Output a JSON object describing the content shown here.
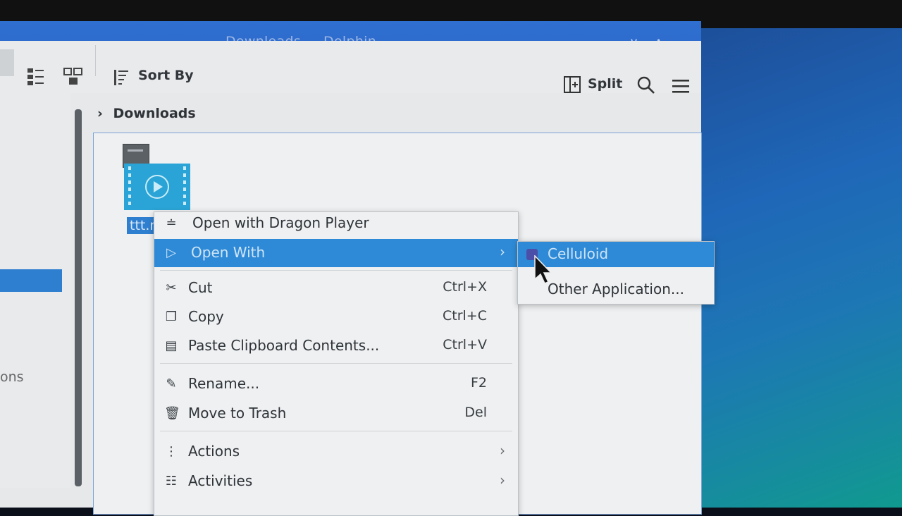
{
  "window": {
    "title": "Downloads — Dolphin"
  },
  "toolbar": {
    "sort_by_label": "Sort By",
    "split_label": "Split"
  },
  "breadcrumb": {
    "chevron": "›",
    "path": "Downloads"
  },
  "places": {
    "partial_label": "ons"
  },
  "file": {
    "name": "ttt.m"
  },
  "context_menu": {
    "items": [
      {
        "label": "Open with Dragon Player",
        "icon": "dragon-player-icon"
      },
      {
        "label": "Open With",
        "icon": "open-with-icon",
        "submenu_arrow": "›"
      },
      {
        "label": "Cut",
        "shortcut": "Ctrl+X",
        "icon": "scissors-icon"
      },
      {
        "label": "Copy",
        "shortcut": "Ctrl+C",
        "icon": "copy-icon"
      },
      {
        "label": "Paste Clipboard Contents...",
        "shortcut": "Ctrl+V",
        "icon": "paste-icon"
      },
      {
        "label": "Rename...",
        "shortcut": "F2",
        "icon": "pencil-icon"
      },
      {
        "label": "Move to Trash",
        "shortcut": "Del",
        "icon": "trash-icon"
      },
      {
        "label": "Actions",
        "icon": "actions-icon",
        "submenu_arrow": "›"
      },
      {
        "label": "Activities",
        "icon": "activities-icon",
        "submenu_arrow": "›"
      }
    ]
  },
  "open_with_submenu": {
    "items": [
      {
        "label": "Celluloid",
        "icon": "celluloid-icon"
      },
      {
        "label": "Other Application..."
      }
    ]
  },
  "colors": {
    "titlebar": "#2d6acb",
    "highlight": "#2e8ad6",
    "selection": "#2e7fd0"
  }
}
